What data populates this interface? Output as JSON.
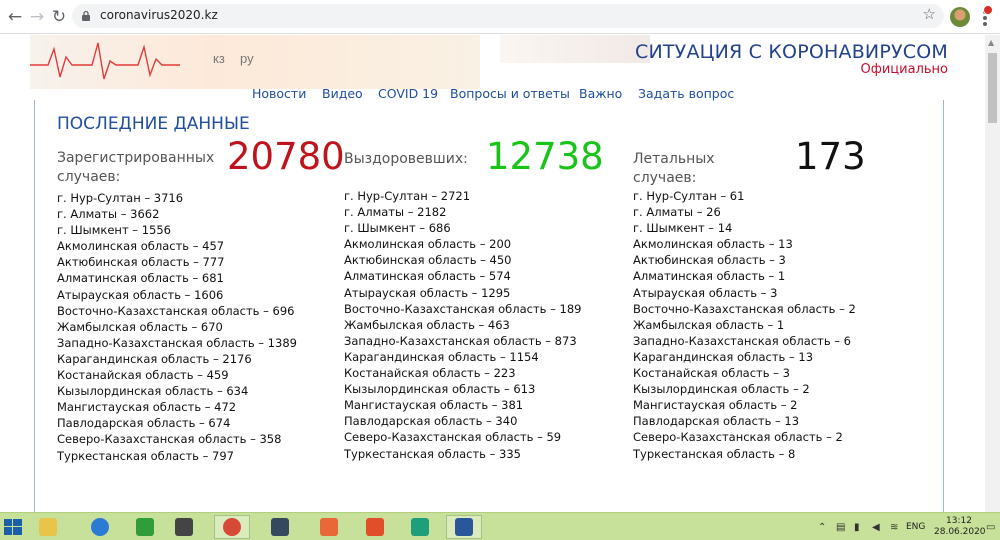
{
  "browser": {
    "back_icon": "←",
    "forward_icon": "→",
    "reload_icon": "↻",
    "url": "coronavirus2020.kz",
    "star_icon": "☆"
  },
  "header": {
    "lang_kz": "кз",
    "lang_ru": "ру",
    "title": "СИТУАЦИЯ С КОРОНАВИРУСОМ",
    "subtitle": "Официально"
  },
  "nav": [
    {
      "label": "Новости"
    },
    {
      "label": "Видео"
    },
    {
      "label": "COVID 19"
    },
    {
      "label": "Вопросы и ответы"
    },
    {
      "label": "Важно"
    },
    {
      "label": "Задать вопрос"
    }
  ],
  "main": {
    "section_title": "ПОСЛЕДНИЕ ДАННЫЕ",
    "registered": {
      "label_line1": "Зарегистрированных",
      "label_line2": "случаев:",
      "total": "20780",
      "color": "#c0141c",
      "items": [
        "г. Нур-Султан – 3716",
        "г. Алматы – 3662",
        "г. Шымкент – 1556",
        "Акмолинская область – 457",
        "Актюбинская область – 777",
        "Алматинская область – 681",
        "Атырауская область – 1606",
        "Восточно-Казахстанская область – 696",
        "Жамбылская область – 670",
        "Западно-Казахстанская область – 1389",
        "Карагандинская область – 2176",
        "Костанайская область – 459",
        "Кызылординская область – 634",
        "Мангистауская область – 472",
        "Павлодарская область – 674",
        "Северо-Казахстанская область – 358",
        "Туркестанская область – 797"
      ]
    },
    "recovered": {
      "label": "Выздоровевших:",
      "total": "12738",
      "color": "#19c419",
      "items": [
        "г. Нур-Султан – 2721",
        "г. Алматы – 2182",
        "г. Шымкент – 686",
        "Акмолинская область – 200",
        "Актюбинская область – 450",
        "Алматинская область – 574",
        "Атырауская область – 1295",
        "Восточно-Казахстанская область – 189",
        "Жамбылская область – 463",
        "Западно-Казахстанская область – 873",
        "Карагандинская область – 1154",
        "Костанайская область – 223",
        "Кызылординская область – 613",
        "Мангистауская область – 381",
        "Павлодарская область – 340",
        "Северо-Казахстанская область – 59",
        "Туркестанская область – 335"
      ]
    },
    "deaths": {
      "label": "Летальных случаев:",
      "total": "173",
      "color": "#111111",
      "items": [
        "г. Нур-Султан – 61",
        "г. Алматы – 26",
        "г. Шымкент – 14",
        "Акмолинская область – 13",
        "Актюбинская область – 3",
        "Алматинская область – 1",
        "Атырауская область – 3",
        "Восточно-Казахстанская область – 2",
        "Жамбылская область – 1",
        "Западно-Казахстанская область – 6",
        "Карагандинская область – 13",
        "Костанайская область – 3",
        "Кызылординская область – 2",
        "Мангистауская область – 2",
        "Павлодарская область – 13",
        "Северо-Казахстанская область – 2",
        "Туркестанская область – 8"
      ]
    }
  },
  "taskbar": {
    "apps": [
      {
        "icon": "file-explorer-icon"
      },
      {
        "icon": "internet-explorer-icon"
      },
      {
        "icon": "store-icon"
      },
      {
        "icon": "microphone-icon"
      },
      {
        "icon": "chrome-icon"
      },
      {
        "icon": "editor-icon"
      },
      {
        "icon": "camera-icon"
      },
      {
        "icon": "screen-recorder-icon"
      },
      {
        "icon": "app-icon"
      },
      {
        "icon": "word-icon"
      }
    ],
    "language": "ENG",
    "time": "13:12",
    "date": "28.06.2020"
  }
}
